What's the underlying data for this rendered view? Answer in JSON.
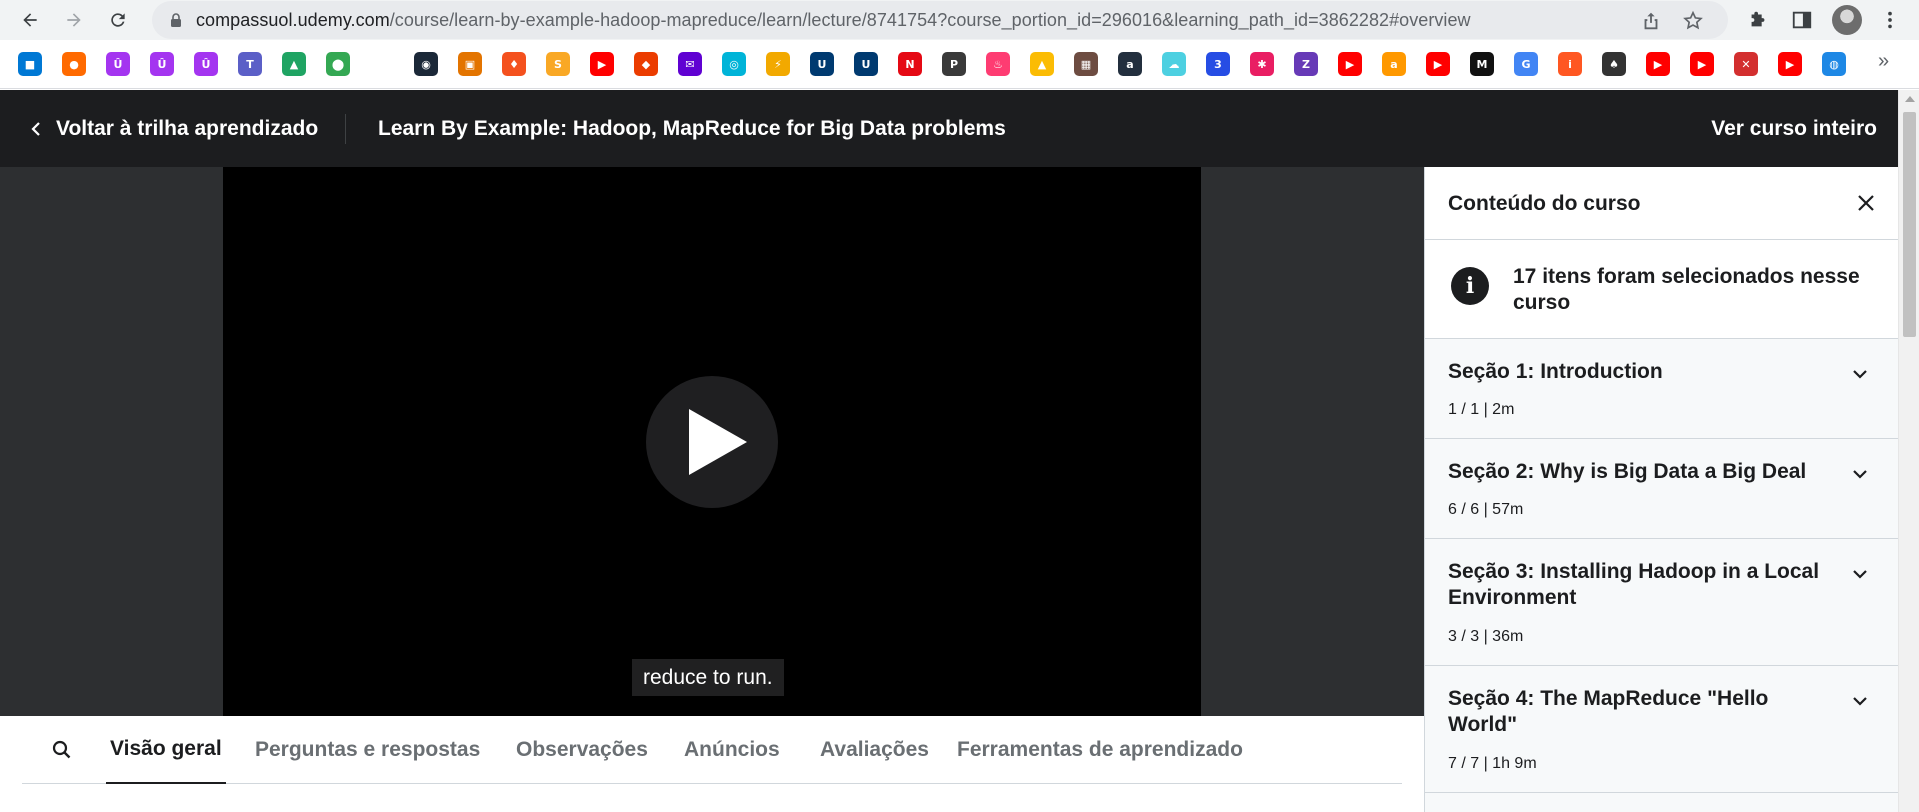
{
  "browser": {
    "url_host": "compassuol.udemy.com",
    "url_path": "/course/learn-by-example-hadoop-mapreduce/learn/lecture/8741754?course_portion_id=296016&learning_path_id=3862282#overview",
    "bookmarks": [
      {
        "icon": "windows-icon",
        "color": "#0078d4",
        "glyph": "■"
      },
      {
        "icon": "orange-app-icon",
        "color": "#ff6a00",
        "glyph": "●"
      },
      {
        "icon": "udemy-icon",
        "color": "#a435f0",
        "glyph": "Û"
      },
      {
        "icon": "udemy-icon",
        "color": "#a435f0",
        "glyph": "Û"
      },
      {
        "icon": "udemy-icon",
        "color": "#a435f0",
        "glyph": "Û"
      },
      {
        "icon": "teams-icon",
        "color": "#5b5fc7",
        "glyph": "T"
      },
      {
        "icon": "drive-icon",
        "color": "#1fa463",
        "glyph": "▲"
      },
      {
        "icon": "maps-icon",
        "color": "#34a853",
        "glyph": "⬤"
      },
      {
        "icon": "steam-icon",
        "color": "#1b2838",
        "glyph": "◉"
      },
      {
        "icon": "contacts-icon",
        "color": "#e37400",
        "glyph": "▣"
      },
      {
        "icon": "fire-icon",
        "color": "#f4511e",
        "glyph": "♦"
      },
      {
        "icon": "s-icon",
        "color": "#f9a825",
        "glyph": "S"
      },
      {
        "icon": "youtube-icon",
        "color": "#ff0000",
        "glyph": "▶"
      },
      {
        "icon": "office-icon",
        "color": "#eb3c00",
        "glyph": "◆"
      },
      {
        "icon": "mail-icon",
        "color": "#6001d2",
        "glyph": "✉"
      },
      {
        "icon": "globe-icon",
        "color": "#00b4d8",
        "glyph": "◎"
      },
      {
        "icon": "plug-icon",
        "color": "#f2a900",
        "glyph": "⚡"
      },
      {
        "icon": "uol-icon",
        "color": "#003a70",
        "glyph": "U"
      },
      {
        "icon": "uol-icon",
        "color": "#003a70",
        "glyph": "U"
      },
      {
        "icon": "netflix-icon",
        "color": "#e50914",
        "glyph": "N"
      },
      {
        "icon": "pje-icon",
        "color": "#3a3a3a",
        "glyph": "P"
      },
      {
        "icon": "tinder-icon",
        "color": "#fe3c72",
        "glyph": "♨"
      },
      {
        "icon": "ads-icon",
        "color": "#fbbc04",
        "glyph": "▲"
      },
      {
        "icon": "game-icon",
        "color": "#6d4c41",
        "glyph": "▦"
      },
      {
        "icon": "amazon-a-icon",
        "color": "#232f3e",
        "glyph": "a"
      },
      {
        "icon": "cloud-icon",
        "color": "#4dd0e1",
        "glyph": "☁"
      },
      {
        "icon": "css-icon",
        "color": "#264de4",
        "glyph": "3"
      },
      {
        "icon": "puzzle-color-icon",
        "color": "#e91e63",
        "glyph": "✱"
      },
      {
        "icon": "z-icon",
        "color": "#673ab7",
        "glyph": "Z"
      },
      {
        "icon": "youtube-icon",
        "color": "#ff0000",
        "glyph": "▶"
      },
      {
        "icon": "amazon-icon",
        "color": "#ff9900",
        "glyph": "a"
      },
      {
        "icon": "youtube-icon",
        "color": "#ff0000",
        "glyph": "▶"
      },
      {
        "icon": "mpc-icon",
        "color": "#111111",
        "glyph": "M"
      },
      {
        "icon": "google-icon",
        "color": "#4285f4",
        "glyph": "G"
      },
      {
        "icon": "info-square-icon",
        "color": "#ff5722",
        "glyph": "i"
      },
      {
        "icon": "spade-icon",
        "color": "#333333",
        "glyph": "♠"
      },
      {
        "icon": "youtube-icon",
        "color": "#ff0000",
        "glyph": "▶"
      },
      {
        "icon": "youtube-icon",
        "color": "#ff0000",
        "glyph": "▶"
      },
      {
        "icon": "tool-icon",
        "color": "#d32f2f",
        "glyph": "✕"
      },
      {
        "icon": "youtube-icon",
        "color": "#ff0000",
        "glyph": "▶"
      },
      {
        "icon": "planet-icon",
        "color": "#1e88e5",
        "glyph": "◍"
      }
    ]
  },
  "header": {
    "back_label": "Voltar à trilha aprendizado",
    "course_title": "Learn By Example: Hadoop, MapReduce for Big Data problems",
    "view_course_label": "Ver curso inteiro"
  },
  "video": {
    "caption": "reduce to run."
  },
  "tabs": [
    {
      "label": "Visão geral",
      "active": true
    },
    {
      "label": "Perguntas e respostas",
      "active": false
    },
    {
      "label": "Observações",
      "active": false
    },
    {
      "label": "Anúncios",
      "active": false
    },
    {
      "label": "Avaliações",
      "active": false
    },
    {
      "label": "Ferramentas de aprendizado",
      "active": false
    }
  ],
  "sidebar": {
    "title": "Conteúdo do curso",
    "notice": "17 itens foram selecionados nesse curso",
    "sections": [
      {
        "title": "Seção 1: Introduction",
        "meta": "1 / 1 | 2m"
      },
      {
        "title": "Seção 2: Why is Big Data a Big Deal",
        "meta": "6 / 6 | 57m"
      },
      {
        "title": "Seção 3: Installing Hadoop in a Local Environment",
        "meta": "3 / 3 | 36m"
      },
      {
        "title": "Seção 4: The MapReduce \"Hello World\"",
        "meta": "7 / 7 | 1h 9m"
      }
    ]
  }
}
